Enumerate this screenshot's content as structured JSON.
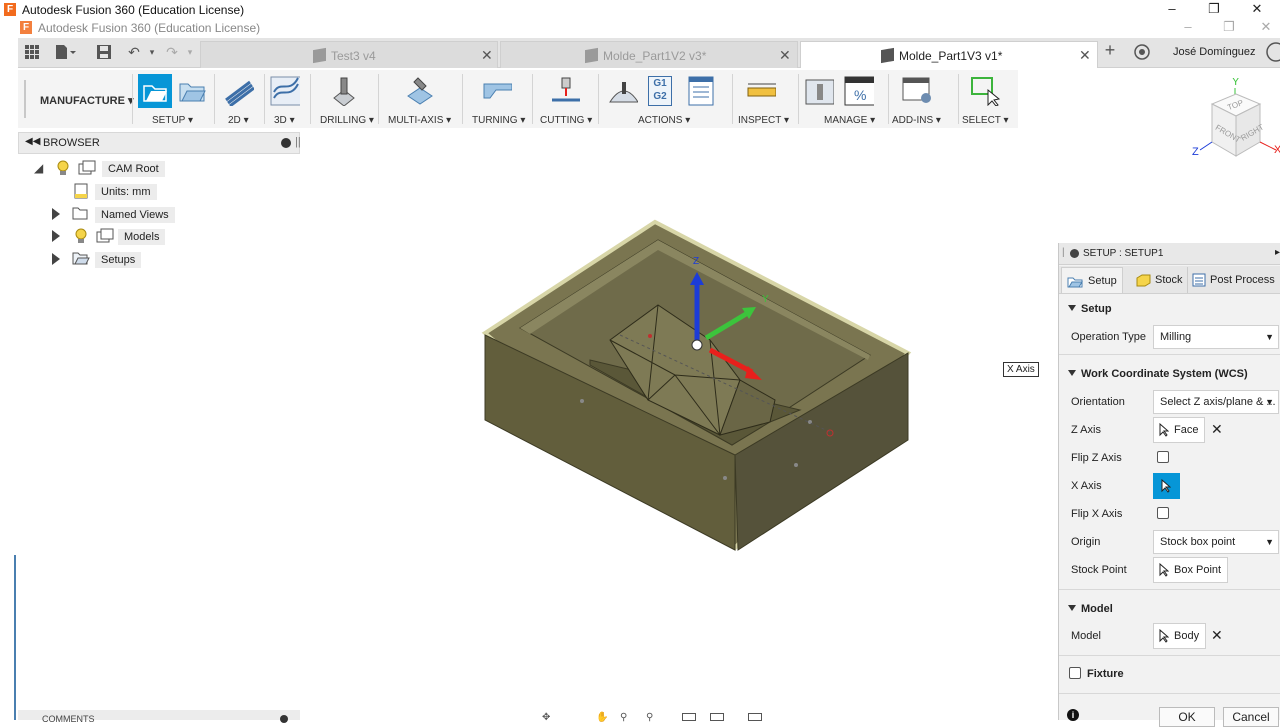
{
  "window": {
    "title": "Autodesk Fusion 360 (Education License)",
    "subtitle": "Autodesk Fusion 360 (Education License)",
    "controls": [
      "minimize-icon",
      "restore-icon",
      "close-icon"
    ]
  },
  "tabs": [
    {
      "label": "Test3 v4",
      "active": false
    },
    {
      "label": "Molde_Part1V2 v3*",
      "active": false
    },
    {
      "label": "Molde_Part1V3 v1*",
      "active": true
    }
  ],
  "user": {
    "name": "José Domínguez"
  },
  "ribbon": {
    "workspace": "MANUFACTURE",
    "groups": [
      {
        "label": "SETUP"
      },
      {
        "label": "2D"
      },
      {
        "label": "3D"
      },
      {
        "label": "DRILLING"
      },
      {
        "label": "MULTI-AXIS"
      },
      {
        "label": "TURNING"
      },
      {
        "label": "CUTTING"
      },
      {
        "label": "ACTIONS"
      },
      {
        "label": "INSPECT"
      },
      {
        "label": "MANAGE"
      },
      {
        "label": "ADD-INS"
      },
      {
        "label": "SELECT"
      }
    ],
    "actions_icon_text": [
      "G1",
      "G2"
    ]
  },
  "browser": {
    "title": "BROWSER",
    "items": [
      {
        "label": "CAM Root"
      },
      {
        "label": "Units: mm"
      },
      {
        "label": "Named Views"
      },
      {
        "label": "Models"
      },
      {
        "label": "Setups"
      }
    ]
  },
  "viewcube": {
    "top": "TOP",
    "front": "FRONT",
    "right": "RIGHT",
    "axes": [
      "Y",
      "X",
      "Z"
    ]
  },
  "viewport": {
    "tooltip": "X Axis",
    "triad": {
      "z": "Z",
      "y": "Y"
    }
  },
  "setup_panel": {
    "title": "SETUP : SETUP1",
    "tabs": [
      "Setup",
      "Stock",
      "Post Process"
    ],
    "sections": {
      "setup": "Setup",
      "wcs": "Work Coordinate System (WCS)",
      "model": "Model",
      "fixture": "Fixture"
    },
    "fields": {
      "operation_type": {
        "label": "Operation Type",
        "value": "Milling"
      },
      "orientation": {
        "label": "Orientation",
        "value": "Select Z axis/plane & ..."
      },
      "z_axis": {
        "label": "Z Axis",
        "value": "Face"
      },
      "flip_z": {
        "label": "Flip Z Axis"
      },
      "x_axis": {
        "label": "X Axis"
      },
      "flip_x": {
        "label": "Flip X Axis"
      },
      "origin": {
        "label": "Origin",
        "value": "Stock box point"
      },
      "stock_point": {
        "label": "Stock Point",
        "value": "Box Point"
      },
      "model": {
        "label": "Model",
        "value": "Body"
      }
    },
    "buttons": {
      "ok": "OK",
      "cancel": "Cancel"
    }
  },
  "comments": {
    "title": "COMMENTS"
  },
  "colors": {
    "accent": "#0696d7",
    "part_body": "#6e6a48",
    "part_edge": "#d8d6a8",
    "axis_x": "#e8201c",
    "axis_y": "#3cc43c",
    "axis_z": "#1c3cd8"
  }
}
